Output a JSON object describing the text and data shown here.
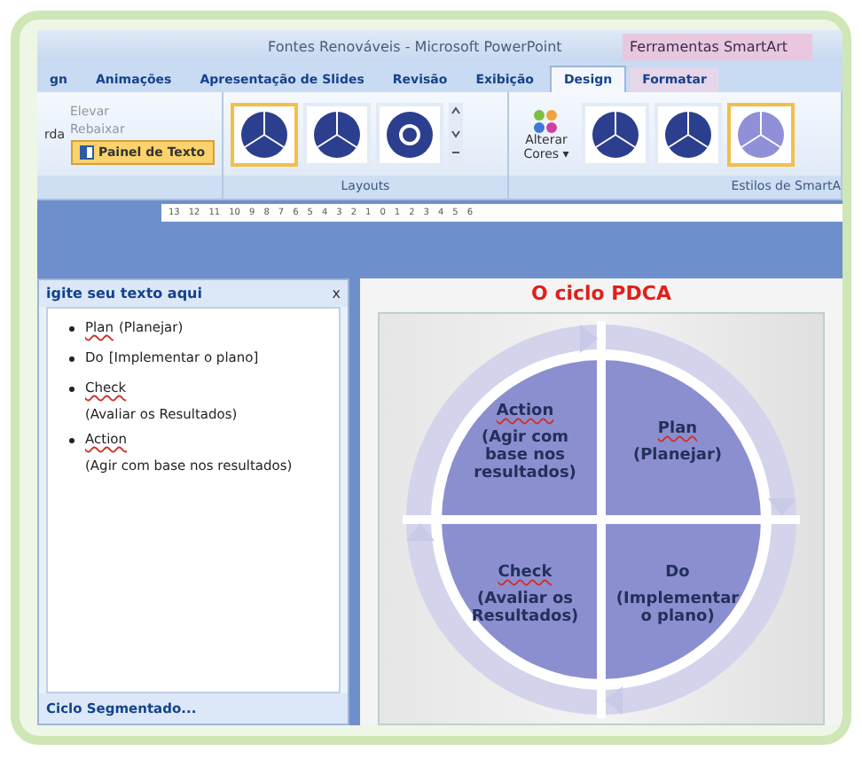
{
  "window": {
    "title": "Fontes Renováveis - Microsoft PowerPoint",
    "context_group": "Ferramentas SmartArt"
  },
  "tabs": [
    {
      "label": "gn",
      "selected": false,
      "kind": "normal"
    },
    {
      "label": "Animações",
      "selected": false,
      "kind": "normal"
    },
    {
      "label": "Apresentação de Slides",
      "selected": false,
      "kind": "normal"
    },
    {
      "label": "Revisão",
      "selected": false,
      "kind": "normal"
    },
    {
      "label": "Exibição",
      "selected": false,
      "kind": "normal"
    },
    {
      "label": "Design",
      "selected": true,
      "kind": "contextual"
    },
    {
      "label": "Formatar",
      "selected": false,
      "kind": "contextual"
    }
  ],
  "ribbon": {
    "graphic_group": {
      "cut_label": "rda",
      "commands": [
        {
          "label": "Elevar",
          "disabled": true
        },
        {
          "label": "Rebaixar",
          "disabled": true
        }
      ],
      "text_pane_button": {
        "label": "Painel de Texto",
        "selected": true
      }
    },
    "layouts": {
      "label": "Layouts",
      "items": [
        {
          "selected": true
        },
        {
          "selected": false
        },
        {
          "selected": false
        }
      ]
    },
    "styles": {
      "change_colors": "Alterar Cores ▾",
      "label": "Estilos de SmartA",
      "items": [
        {
          "selected": false
        },
        {
          "selected": false
        },
        {
          "selected": true
        }
      ]
    }
  },
  "ruler": [
    "13",
    "12",
    "11",
    "10",
    "9",
    "8",
    "7",
    "6",
    "5",
    "4",
    "3",
    "2",
    "1",
    "0",
    "1",
    "2",
    "3",
    "4",
    "5",
    "6"
  ],
  "text_pane": {
    "title": "igite seu texto aqui",
    "close": "x",
    "bullets": [
      {
        "title": "Plan",
        "note": "(Planejar)",
        "misspelled": true,
        "wrap": false
      },
      {
        "title": "Do",
        "note": "[Implementar o plano]",
        "misspelled": false,
        "wrap": false
      },
      {
        "title": "Check",
        "note": "(Avaliar os Resultados)",
        "misspelled": true,
        "wrap": true
      },
      {
        "title": "Action",
        "note": "(Agir com base nos resultados)",
        "misspelled": true,
        "wrap": true
      }
    ],
    "footer": "Ciclo Segmentado..."
  },
  "slide": {
    "title": "O ciclo PDCA",
    "quadrants": [
      {
        "title": "Action",
        "note": "(Agir com base nos resultados)",
        "misspelled": true
      },
      {
        "title": "Plan",
        "note": "(Planejar)",
        "misspelled": true
      },
      {
        "title": "Check",
        "note": "(Avaliar os Resultados)",
        "misspelled": true
      },
      {
        "title": "Do",
        "note": "(Implementar o plano)",
        "misspelled": false
      }
    ]
  }
}
